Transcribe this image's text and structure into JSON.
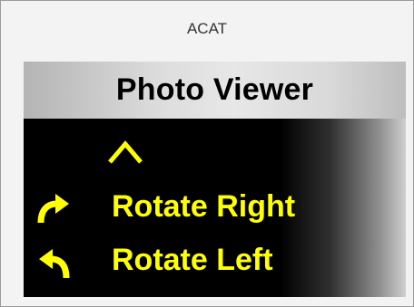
{
  "window": {
    "title": "ACAT"
  },
  "panel": {
    "title": "Photo Viewer",
    "items": [
      {
        "label": "",
        "icon": "caret-up-icon"
      },
      {
        "label": "Rotate Right",
        "icon": "rotate-right-arrow-icon"
      },
      {
        "label": "Rotate Left",
        "icon": "rotate-left-arrow-icon"
      }
    ]
  },
  "colors": {
    "menu_text": "#ffff00",
    "menu_background": "#000000",
    "header_background": "#e2e2e2",
    "window_background": "#f3f3f3"
  }
}
